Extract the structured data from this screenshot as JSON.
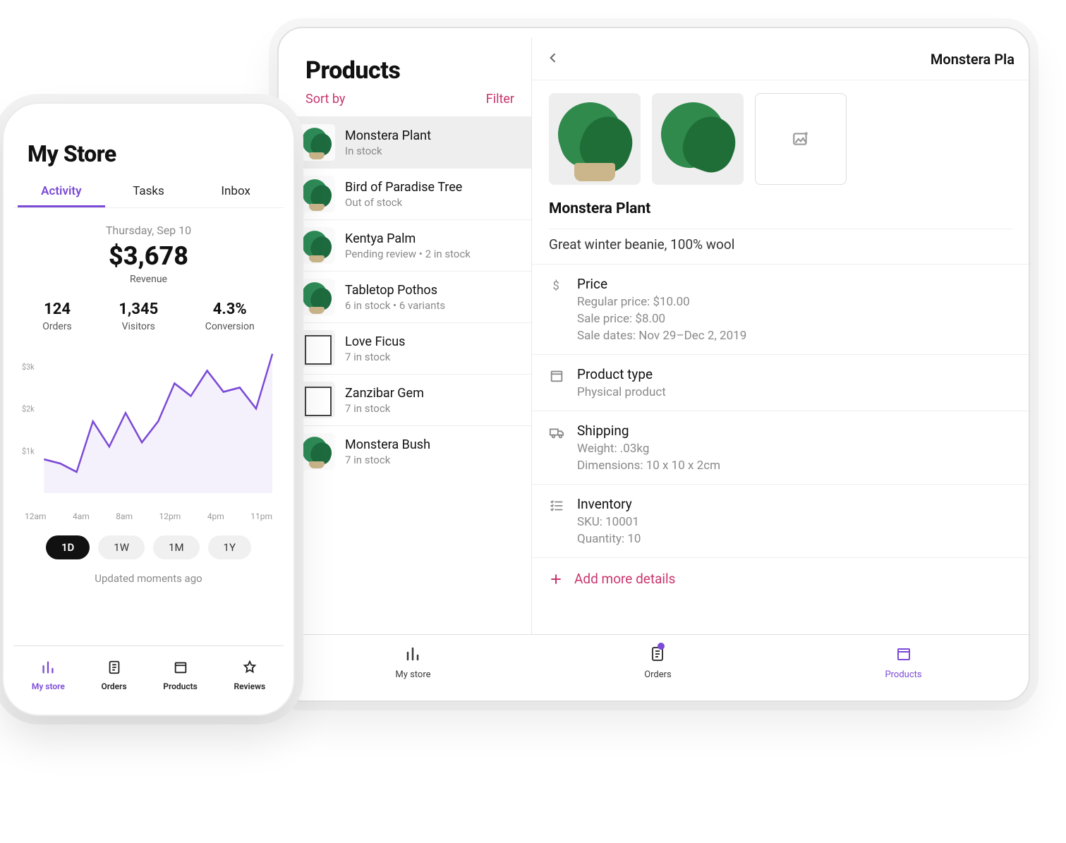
{
  "tablet": {
    "listTitle": "Products",
    "sort": "Sort by",
    "filter": "Filter",
    "headerTitle": "Monstera Pla",
    "items": [
      {
        "name": "Monstera Plant",
        "sub": "In stock",
        "selected": true
      },
      {
        "name": "Bird of Paradise Tree",
        "sub": "Out of stock"
      },
      {
        "name": "Kentya Palm",
        "sub": "Pending review • 2 in stock"
      },
      {
        "name": "Tabletop Pothos",
        "sub": "6 in stock • 6 variants"
      },
      {
        "name": "Love Ficus",
        "sub": "7 in stock"
      },
      {
        "name": "Zanzibar Gem",
        "sub": "7 in stock"
      },
      {
        "name": "Monstera Bush",
        "sub": "7 in stock"
      }
    ],
    "detail": {
      "name": "Monstera Plant",
      "description": "Great winter beanie, 100% wool",
      "price": {
        "heading": "Price",
        "regular": "Regular price: $10.00",
        "sale": "Sale price: $8.00",
        "dates": "Sale dates: Nov 29–Dec 2, 2019"
      },
      "productType": {
        "heading": "Product type",
        "line": "Physical product"
      },
      "shipping": {
        "heading": "Shipping",
        "weight": "Weight: .03kg",
        "dims": "Dimensions: 10 x 10 x 2cm"
      },
      "inventory": {
        "heading": "Inventory",
        "sku": "SKU: 10001",
        "qty": "Quantity: 10"
      },
      "addMore": "Add more details"
    },
    "tabs": [
      {
        "key": "mystore",
        "label": "My store",
        "icon": "bar-chart"
      },
      {
        "key": "orders",
        "label": "Orders",
        "icon": "receipt",
        "badge": true
      },
      {
        "key": "products",
        "label": "Products",
        "icon": "box",
        "active": true
      }
    ]
  },
  "phone": {
    "title": "My Store",
    "tabs": [
      {
        "key": "activity",
        "label": "Activity",
        "active": true
      },
      {
        "key": "tasks",
        "label": "Tasks"
      },
      {
        "key": "inbox",
        "label": "Inbox"
      }
    ],
    "date": "Thursday, Sep 10",
    "revenue": "$3,678",
    "revenueLabel": "Revenue",
    "stats": [
      {
        "value": "124",
        "label": "Orders"
      },
      {
        "value": "1,345",
        "label": "Visitors"
      },
      {
        "value": "4.3%",
        "label": "Conversion"
      }
    ],
    "ranges": [
      {
        "label": "1D",
        "active": true
      },
      {
        "label": "1W"
      },
      {
        "label": "1M"
      },
      {
        "label": "1Y"
      }
    ],
    "updated": "Updated moments ago",
    "bottomTabs": [
      {
        "key": "mystore",
        "label": "My store",
        "icon": "bar-chart",
        "active": true
      },
      {
        "key": "orders",
        "label": "Orders",
        "icon": "receipt"
      },
      {
        "key": "products",
        "label": "Products",
        "icon": "box"
      },
      {
        "key": "reviews",
        "label": "Reviews",
        "icon": "star"
      }
    ]
  },
  "chart_data": {
    "type": "line",
    "title": "Revenue",
    "xlabel": "",
    "ylabel": "",
    "ylim": [
      0,
      3400
    ],
    "x_ticks": [
      "12am",
      "4am",
      "8am",
      "12pm",
      "4pm",
      "11pm"
    ],
    "y_ticks": [
      "$1k",
      "$2k",
      "$3k"
    ],
    "x": [
      0,
      1,
      2,
      3,
      4,
      5,
      6,
      7,
      8,
      9,
      10,
      11,
      12,
      13,
      14
    ],
    "values": [
      800,
      700,
      500,
      1700,
      1100,
      1900,
      1200,
      1700,
      2600,
      2300,
      2900,
      2400,
      2500,
      2000,
      3300
    ]
  }
}
